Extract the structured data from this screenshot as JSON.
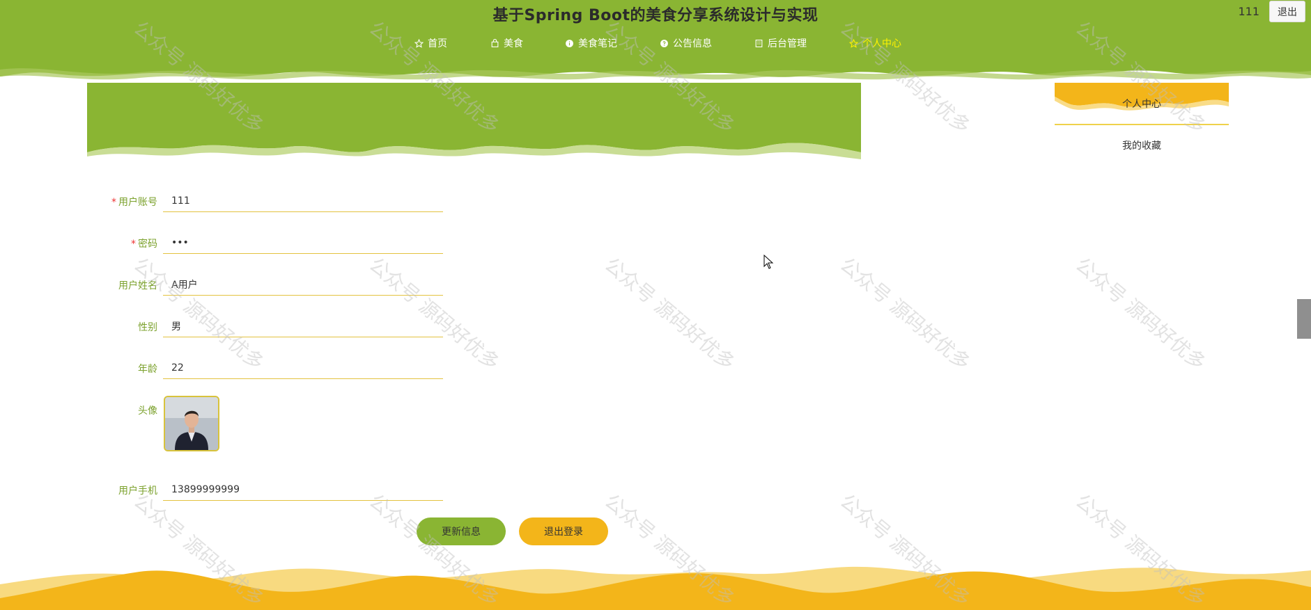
{
  "header": {
    "title": "基于Spring Boot的美食分享系统设计与实现",
    "user_name": "111",
    "logout_label": "退出"
  },
  "nav": {
    "items": [
      {
        "label": "首页",
        "icon": "star-outline-icon"
      },
      {
        "label": "美食",
        "icon": "bag-icon"
      },
      {
        "label": "美食笔记",
        "icon": "info-circle-icon"
      },
      {
        "label": "公告信息",
        "icon": "question-circle-icon"
      },
      {
        "label": "后台管理",
        "icon": "building-icon"
      },
      {
        "label": "个人中心",
        "icon": "star-outline-icon",
        "active": true
      }
    ]
  },
  "side_menu": {
    "title": "个人中心",
    "items": [
      {
        "label": "我的收藏"
      }
    ]
  },
  "form": {
    "account": {
      "label": "用户账号",
      "required": true,
      "value": "111"
    },
    "password": {
      "label": "密码",
      "required": true,
      "value": "•••"
    },
    "name": {
      "label": "用户姓名",
      "value": "A用户"
    },
    "gender": {
      "label": "性别",
      "value": "男"
    },
    "age": {
      "label": "年龄",
      "value": "22"
    },
    "avatar": {
      "label": "头像"
    },
    "phone": {
      "label": "用户手机",
      "value": "13899999999"
    }
  },
  "buttons": {
    "update_label": "更新信息",
    "logout_label": "退出登录"
  },
  "watermark": {
    "text": "公众号 源码好优多"
  },
  "colors": {
    "header_green": "#8ab533",
    "accent_yellow": "#f3b51a",
    "label_green": "#7ba12c",
    "active_nav": "#fff200"
  }
}
